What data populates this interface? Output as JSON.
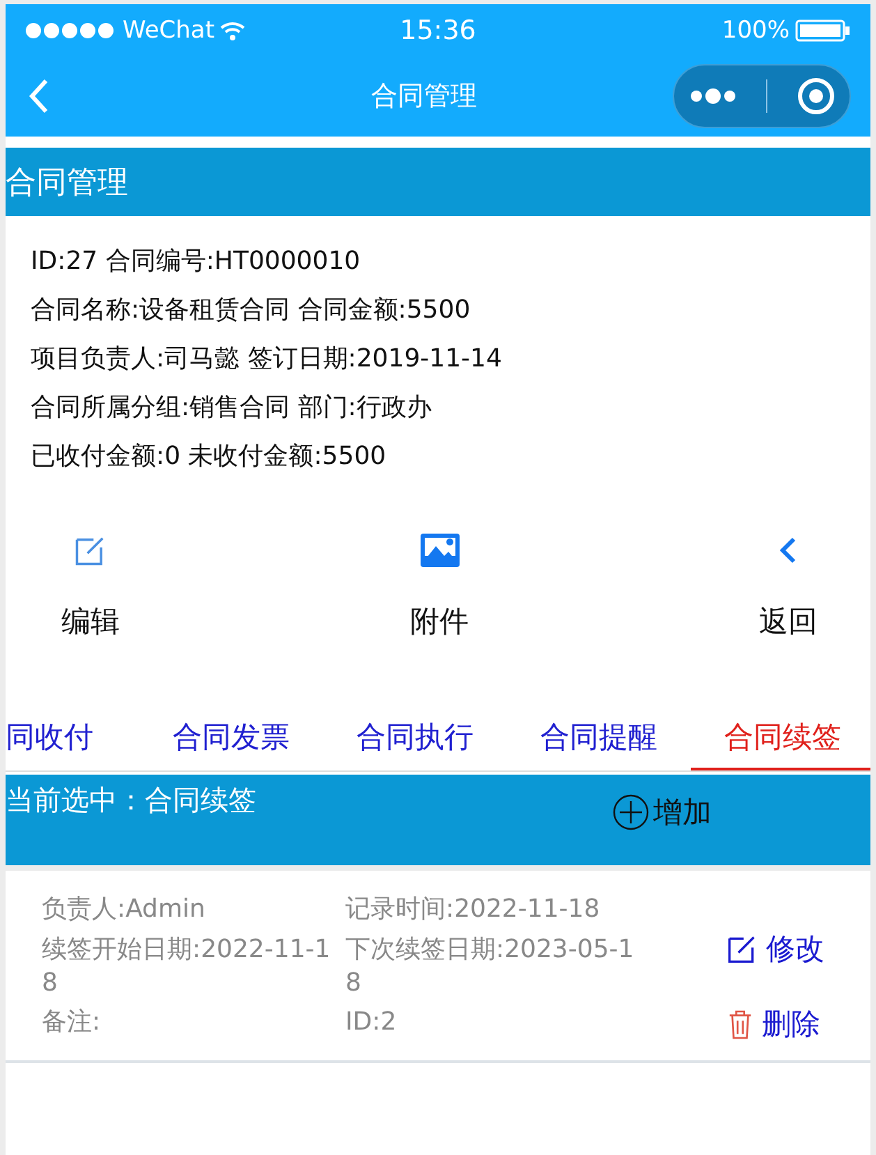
{
  "status_bar": {
    "carrier": "WeChat",
    "time": "15:36",
    "battery": "100%"
  },
  "nav": {
    "title": "合同管理"
  },
  "section": {
    "title": "合同管理"
  },
  "info_lines": [
    "ID:27 合同编号:HT0000010",
    "合同名称:设备租赁合同 合同金额:5500",
    "项目负责人:司马懿 签订日期:2019-11-14",
    "合同所属分组:销售合同 部门:行政办",
    "已收付金额:0 未收付金额:5500"
  ],
  "actions": [
    {
      "kind": "edit",
      "label": "编辑"
    },
    {
      "kind": "image",
      "label": "附件"
    },
    {
      "kind": "back",
      "label": "返回"
    }
  ],
  "tabs": [
    {
      "label": "同收付",
      "selected": false
    },
    {
      "label": "合同发票",
      "selected": false
    },
    {
      "label": "合同执行",
      "selected": false
    },
    {
      "label": "合同提醒",
      "selected": false
    },
    {
      "label": "合同续签",
      "selected": true
    }
  ],
  "selection_bar": {
    "text": "当前选中：合同续签",
    "add": "增加"
  },
  "records": [
    {
      "fields": [
        "负责人:Admin",
        "记录时间:2022-11-18",
        "续签开始日期:2022-11-18",
        "下次续签日期:2023-05-18",
        "备注:",
        "ID:2"
      ],
      "edit": "修改",
      "delete": "删除"
    }
  ]
}
